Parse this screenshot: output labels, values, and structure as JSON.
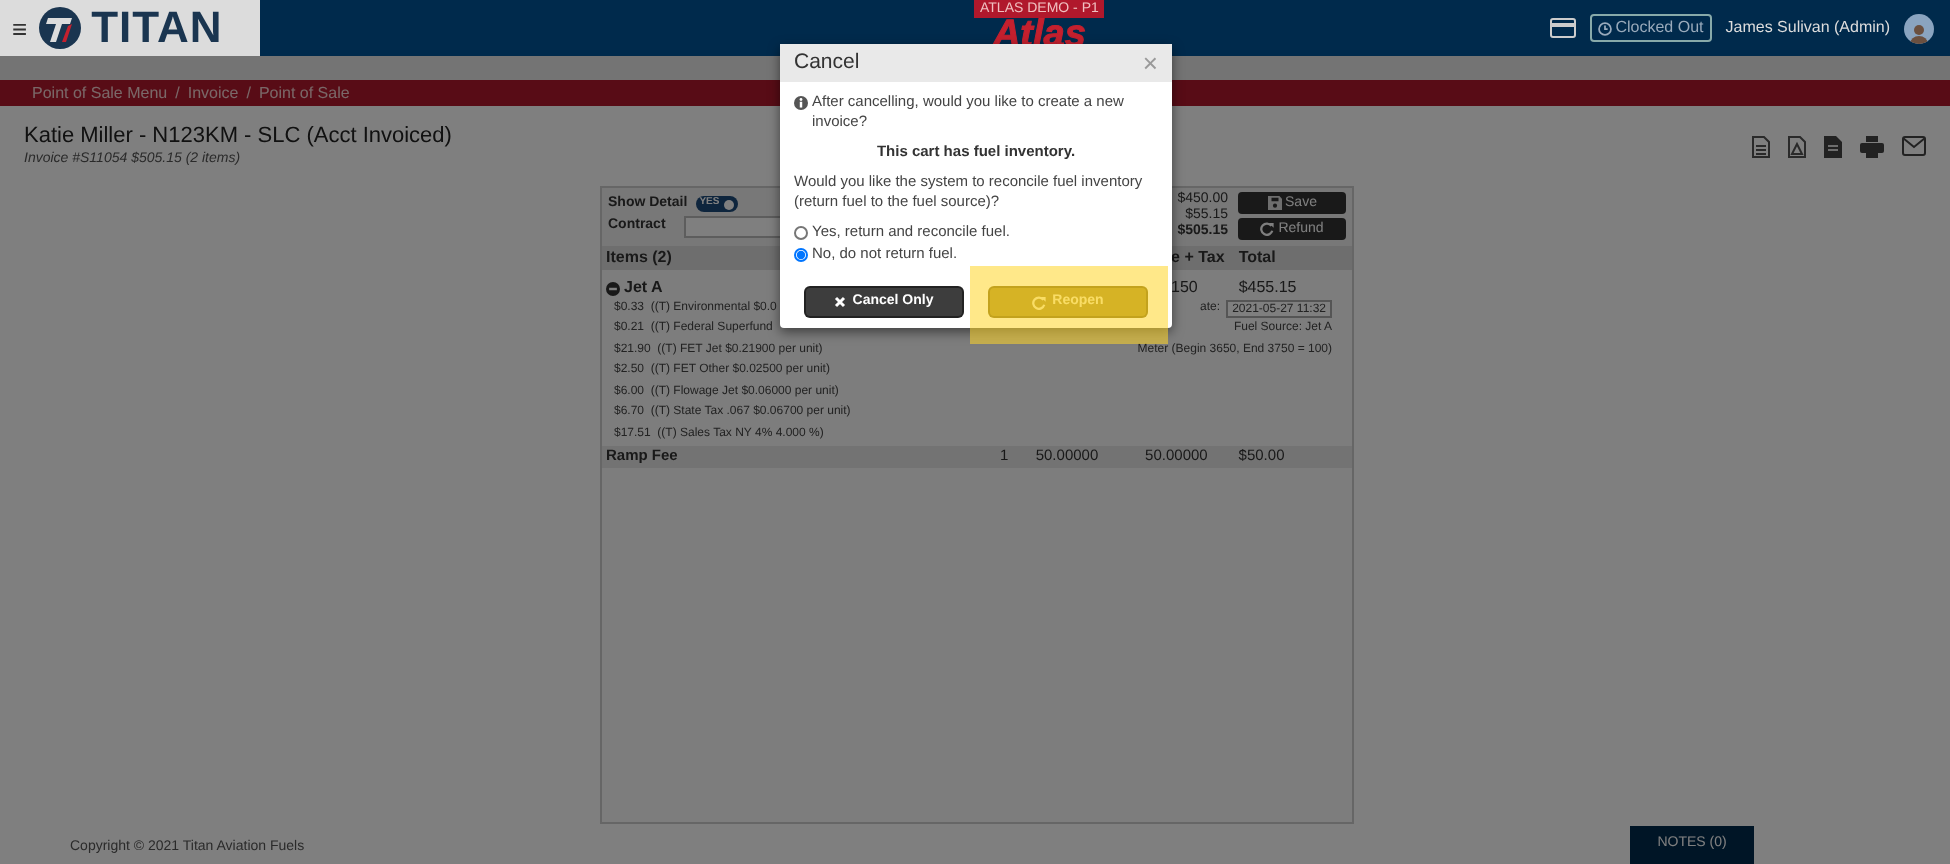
{
  "topbar": {
    "menu_glyph": "≡",
    "logo_text": "TITAN",
    "env_tag": "ATLAS DEMO - P1",
    "app_logo": "Atlas",
    "clock_status": "Clocked Out",
    "user": "James Sulivan (Admin)"
  },
  "breadcrumb": {
    "separator": "/",
    "items": [
      {
        "label": "Point of Sale Menu"
      },
      {
        "label": "Invoice"
      },
      {
        "label": "Point of Sale"
      }
    ]
  },
  "invoice": {
    "title": "Katie Miller - N123KM - SLC (Acct Invoiced)",
    "number": "Invoice #S11054",
    "amount": "$505.15 (2 items)"
  },
  "panel": {
    "show_detail": {
      "label": "Show Detail",
      "on": true,
      "toggle_text": "YES"
    },
    "contract": {
      "label": "Contract"
    },
    "totals": [
      {
        "text": "$450.00",
        "bold": false
      },
      {
        "text": "$55.15",
        "bold": false
      },
      {
        "text": "$505.15",
        "bold": true
      }
    ],
    "buttons": [
      {
        "kind": "save",
        "label": "Save"
      },
      {
        "kind": "refund",
        "label": "Refund"
      }
    ],
    "columns": [
      "Items (2)",
      "e + Tax",
      "Total"
    ],
    "fuel_item": {
      "name": "Jet A",
      "expanded": true,
      "price_tax": "150",
      "total": "$455.15",
      "taxes": [
        {
          "amount": "$0.33",
          "text": "((T) Environmental $0.0"
        },
        {
          "amount": "$0.21",
          "text": "((T) Federal Superfund"
        },
        {
          "amount": "$21.90",
          "text": "((T) FET Jet $0.21900 per unit)"
        },
        {
          "amount": "$2.50",
          "text": "((T) FET Other $0.02500 per unit)"
        },
        {
          "amount": "$6.00",
          "text": "((T) Flowage Jet $0.06000 per unit)"
        },
        {
          "amount": "$6.70",
          "text": "((T) State Tax .067 $0.06700 per unit)"
        },
        {
          "amount": "$17.51",
          "text": "((T) Sales Tax NY 4% 4.000 %)"
        }
      ],
      "date_label": "ate:",
      "date_value": "2021-05-27 11:32",
      "fuel_source": "Fuel Source: Jet A",
      "meter": "Meter (Begin 3650, End 3750 = 100)"
    },
    "ramp_fee": {
      "name": "Ramp Fee",
      "qty": "1",
      "price": "50.00000",
      "price_tax": "50.00000",
      "total": "$50.00"
    }
  },
  "footer": {
    "copyright": "Copyright © 2021 Titan Aviation Fuels",
    "notes": "NOTES (0)"
  },
  "dialog": {
    "title": "Cancel",
    "close_glyph": "×",
    "message": "After cancelling, would you like to create a new invoice?",
    "notice": "This cart has fuel inventory.",
    "question": "Would you like the system to reconcile fuel inventory (return fuel to the fuel source)?",
    "options": [
      {
        "label": "Yes, return and reconcile fuel.",
        "selected": false
      },
      {
        "label": "No, do not return fuel.",
        "selected": true
      }
    ],
    "buttons": [
      {
        "kind": "cancel",
        "label": "Cancel Only",
        "highlighted": false
      },
      {
        "kind": "reopen",
        "label": "Reopen",
        "highlighted": true
      }
    ]
  }
}
